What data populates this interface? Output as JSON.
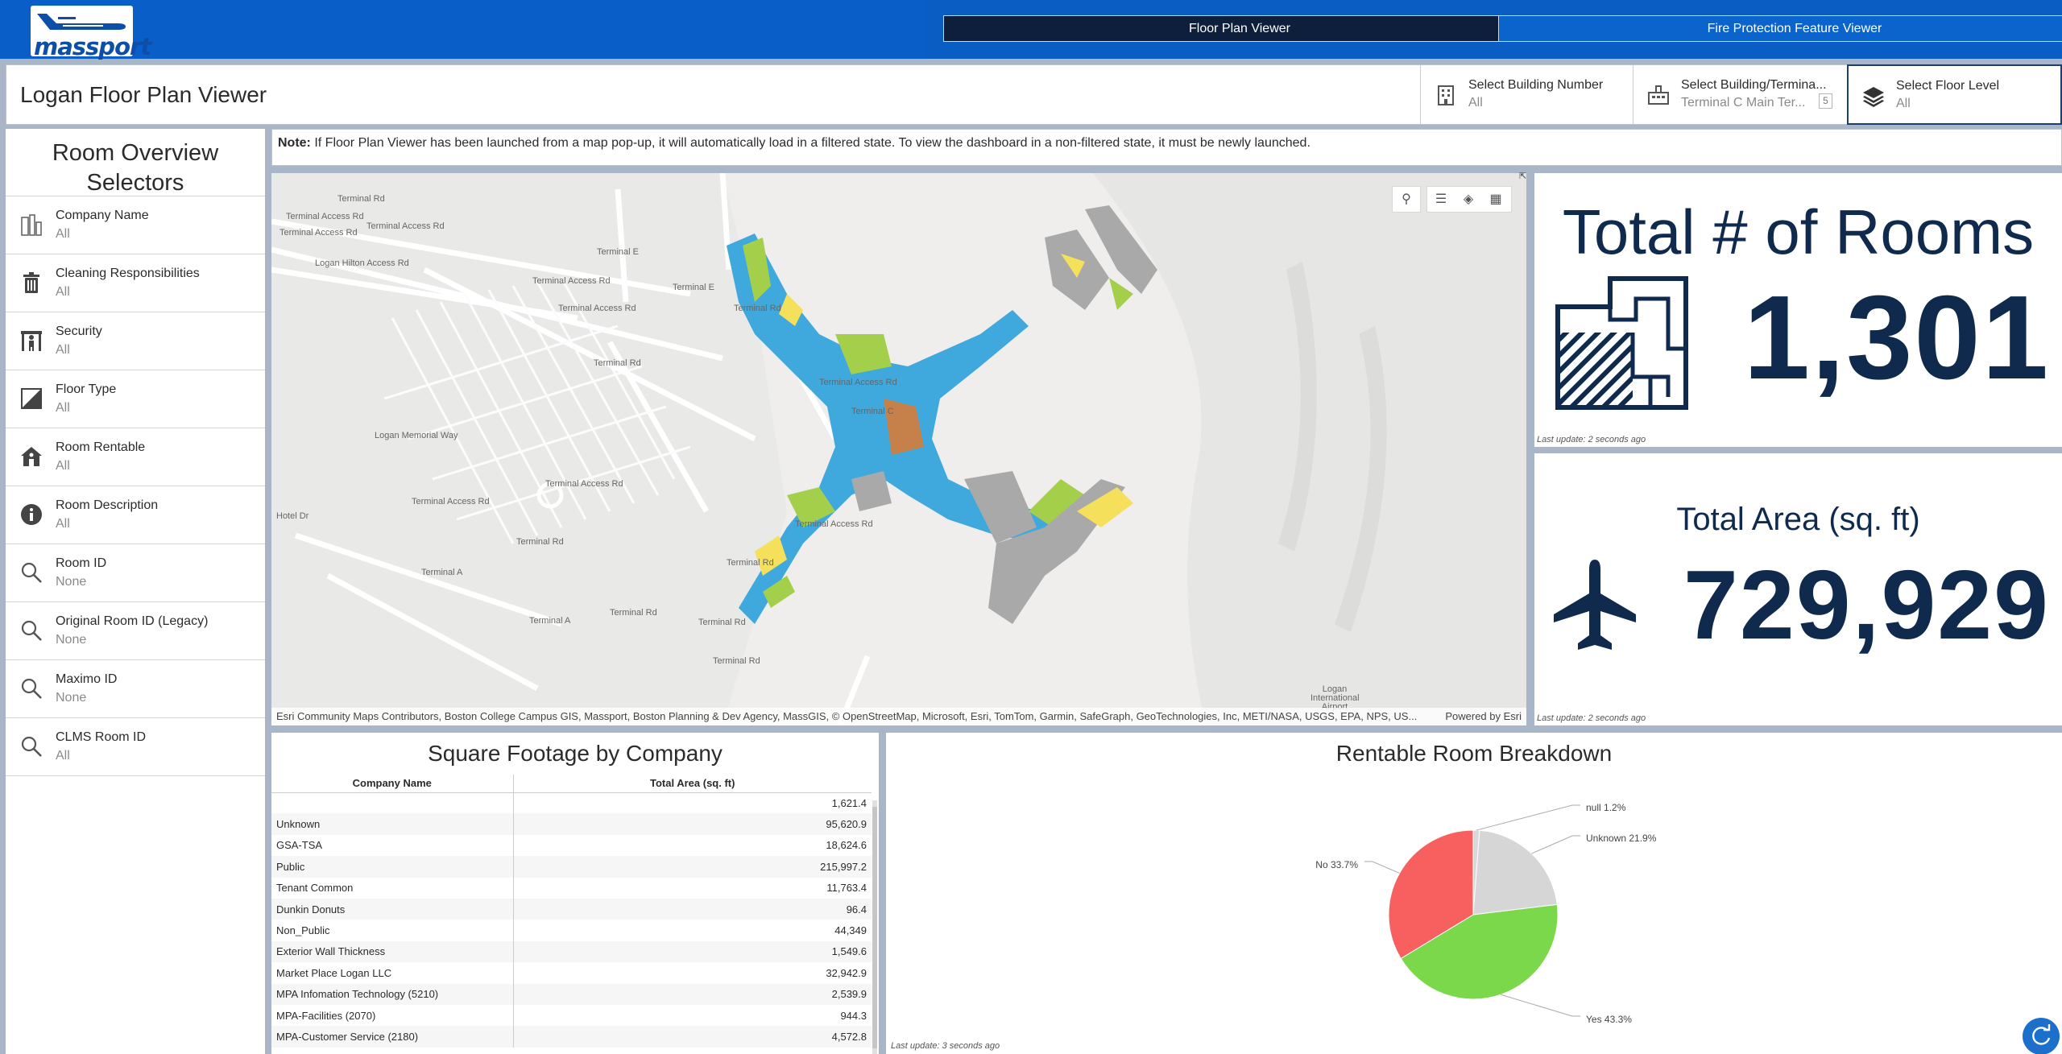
{
  "header": {
    "logo_text": "massport",
    "nav": [
      {
        "label": "Floor Plan Viewer"
      },
      {
        "label": "Fire Protection Feature Viewer"
      }
    ]
  },
  "titlebar": {
    "title": "Logan Floor Plan Viewer",
    "selectors": [
      {
        "label": "Select Building Number",
        "value": "All",
        "icon": "building-icon"
      },
      {
        "label": "Select Building/Termina...",
        "value": "Terminal C Main Ter...",
        "count": "5",
        "icon": "terminal-icon"
      },
      {
        "label": "Select Floor Level",
        "value": "All",
        "icon": "layers-icon"
      }
    ]
  },
  "sidebar": {
    "heading": "Room Overview Selectors",
    "items": [
      {
        "label": "Company Name",
        "value": "All",
        "icon": "company-icon"
      },
      {
        "label": "Cleaning Responsibilities",
        "value": "All",
        "icon": "trash-icon"
      },
      {
        "label": "Security",
        "value": "All",
        "icon": "security-icon"
      },
      {
        "label": "Floor Type",
        "value": "All",
        "icon": "floor-type-icon"
      },
      {
        "label": "Room Rentable",
        "value": "All",
        "icon": "house-icon"
      },
      {
        "label": "Room Description",
        "value": "All",
        "icon": "info-icon"
      },
      {
        "label": "Room ID",
        "value": "None",
        "icon": "search-icon"
      },
      {
        "label": "Original Room ID (Legacy)",
        "value": "None",
        "icon": "search-icon"
      },
      {
        "label": "Maximo ID",
        "value": "None",
        "icon": "search-icon"
      },
      {
        "label": "CLMS Room ID",
        "value": "All",
        "icon": "search-icon"
      }
    ]
  },
  "note": {
    "prefix": "Note:",
    "text": "If Floor Plan Viewer has been launched from a map pop-up, it will automatically load in a filtered state. To view the dashboard in a non-filtered state, it must be newly launched."
  },
  "map": {
    "attribution": "Esri Community Maps Contributors, Boston College Campus GIS, Massport, Boston Planning & Dev Agency, MassGIS, © OpenStreetMap, Microsoft, Esri, TomTom, Garmin, SafeGraph, GeoTechnologies, Inc, METI/NASA, USGS, EPA, NPS, US...",
    "powered_by": "Powered by Esri",
    "labels": [
      "Terminal Rd",
      "Terminal Access Rd",
      "Terminal Access Rd",
      "Terminal Access Rd",
      "Logan Hilton Access Rd",
      "Terminal Access Rd",
      "Terminal Access Rd",
      "Terminal E",
      "Terminal E",
      "Terminal Rd",
      "Terminal Rd",
      "Terminal Access Rd",
      "Terminal C",
      "Logan Memorial Way",
      "Terminal Access Rd",
      "Terminal Access Rd",
      "Terminal Rd",
      "Terminal Access Rd",
      "Terminal Rd",
      "Terminal Rd",
      "Terminal A",
      "Terminal A",
      "Terminal Rd",
      "Terminal Rd",
      "Hotel Dr",
      "Logan International Airport"
    ]
  },
  "kpi_rooms": {
    "title": "Total # of Rooms",
    "value": "1,301",
    "updated": "Last update: 2 seconds ago"
  },
  "kpi_area": {
    "title": "Total Area (sq. ft)",
    "value": "729,929",
    "updated": "Last update: 2 seconds ago"
  },
  "table": {
    "title": "Square Footage by Company",
    "columns": [
      "Company Name",
      "Total Area (sq. ft)"
    ],
    "rows": [
      [
        "",
        "1,621.4"
      ],
      [
        "Unknown",
        "95,620.9"
      ],
      [
        "GSA-TSA",
        "18,624.6"
      ],
      [
        "Public",
        "215,997.2"
      ],
      [
        "Tenant Common",
        "11,763.4"
      ],
      [
        "Dunkin Donuts",
        "96.4"
      ],
      [
        "Non_Public",
        "44,349"
      ],
      [
        "Exterior Wall Thickness",
        "1,549.6"
      ],
      [
        "Market Place Logan LLC",
        "32,942.9"
      ],
      [
        "MPA Infomation Technology (5210)",
        "2,539.9"
      ],
      [
        "MPA-Facilities (2070)",
        "944.3"
      ],
      [
        "MPA-Customer Service (2180)",
        "4,572.8"
      ]
    ]
  },
  "chart_data": {
    "type": "pie",
    "title": "Rentable Room Breakdown",
    "slices": [
      {
        "label": "null",
        "value": 1.2,
        "color": "#d8d8d8"
      },
      {
        "label": "Unknown",
        "value": 21.9,
        "color": "#d6d6d6"
      },
      {
        "label": "Yes",
        "value": 43.3,
        "color": "#7ad84a"
      },
      {
        "label": "No",
        "value": 33.7,
        "color": "#f86060"
      }
    ],
    "slice_labels": [
      "null 1.2%",
      "Unknown 21.9%",
      "Yes 43.3%",
      "No 33.7%"
    ],
    "updated": "Last update: 3 seconds ago"
  },
  "colors": {
    "header_blue": "#0a5ec8",
    "dark_navy": "#0f2a4d",
    "terminal_blue": "#3fa9de",
    "terminal_green": "#a3cf4a",
    "terminal_yellow": "#f4e05a",
    "terminal_gray": "#a9a9a9"
  }
}
